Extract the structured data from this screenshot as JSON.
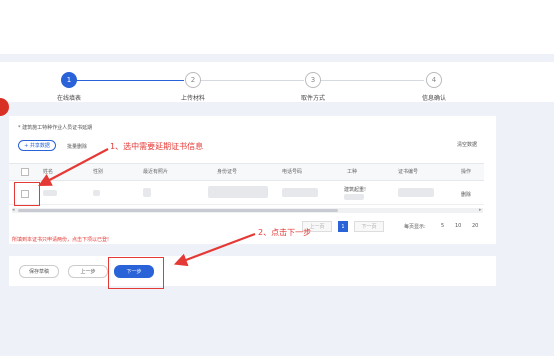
{
  "steps": [
    {
      "num": "1",
      "label": "在线填表"
    },
    {
      "num": "2",
      "label": "上传材料"
    },
    {
      "num": "3",
      "label": "取件方式"
    },
    {
      "num": "4",
      "label": "信息确认"
    }
  ],
  "form": {
    "section_title": "* 建筑施工特种作业人员证书延期",
    "btn_query": "+ 共享数据",
    "btn_delete": "批量删除",
    "btn_clear": "清空数据",
    "columns": [
      "姓名",
      "性别",
      "最近有照片",
      "身份证号",
      "电话号码",
      "工种",
      "证书编号",
      "操作"
    ],
    "row": {
      "job": "建筑起重!",
      "action": "删除"
    },
    "note": "所填到本证书只申请两份，点击下项以已登!",
    "pagination": {
      "prev": "上一页",
      "current": "1",
      "next": "下一页",
      "per_page_label": "每页显示:",
      "per_page_options": [
        "5",
        "10",
        "20"
      ]
    }
  },
  "buttons": {
    "save_draft": "保存草稿",
    "prev_step": "上一步",
    "next_step": "下一步"
  },
  "annotations": {
    "a1": "1、选中需要延期证书信息",
    "a2": "2、点击下一步"
  },
  "colors": {
    "primary": "#2a62d8",
    "annotation": "#e53935"
  }
}
